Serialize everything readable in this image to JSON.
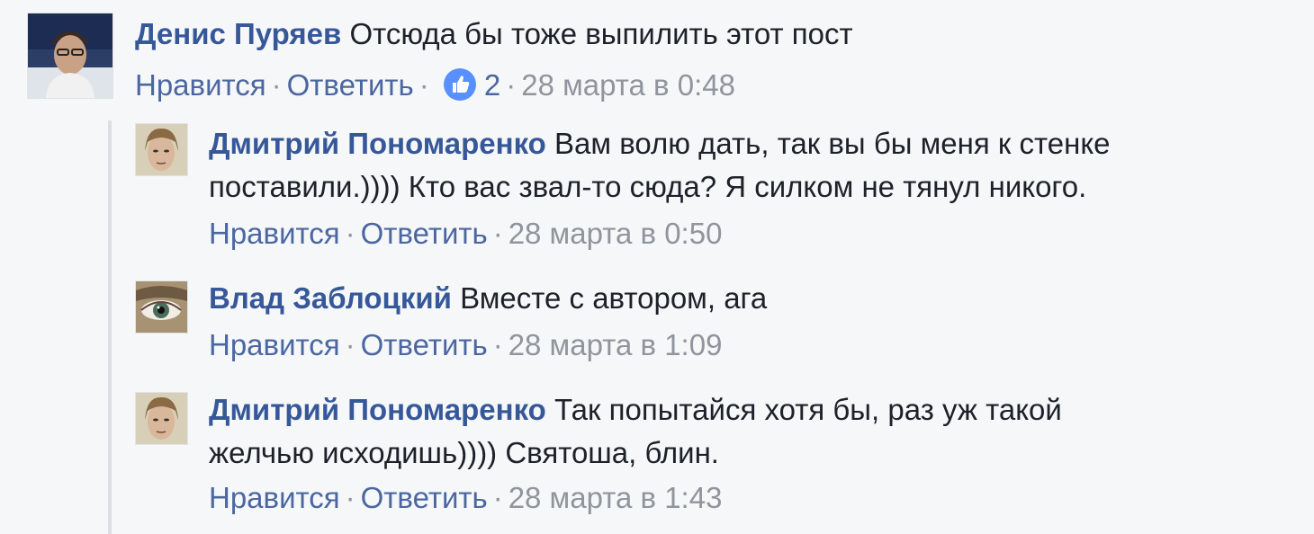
{
  "comments": [
    {
      "author": "Денис Пуряев",
      "body": "Отсюда бы тоже выпилить этот пост",
      "like_label": "Нравится",
      "reply_label": "Ответить",
      "likes": "2",
      "time": "28 марта в 0:48"
    }
  ],
  "replies": [
    {
      "author": "Дмитрий Пономаренко",
      "body_line1": "Вам волю дать, так вы бы меня к стенке",
      "body_line2": "поставили.)))) Кто вас звал-то сюда? Я силком не тянул никого.",
      "like_label": "Нравится",
      "reply_label": "Ответить",
      "time": "28 марта в 0:50"
    },
    {
      "author": "Влад Заблоцкий",
      "body_line1": "Вместе с автором, ага",
      "like_label": "Нравится",
      "reply_label": "Ответить",
      "time": "28 марта в 1:09"
    },
    {
      "author": "Дмитрий Пономаренко",
      "body_line1": "Так попытайся хотя бы, раз уж такой",
      "body_line2": "желчью исходишь)))) Святоша, блин.",
      "like_label": "Нравится",
      "reply_label": "Ответить",
      "time": "28 марта в 1:43"
    }
  ],
  "separator": "·",
  "colors": {
    "background": "#f6f7f9",
    "author": "#365899",
    "link": "#4b67a1",
    "meta": "#90949c",
    "like_badge": "#5890ff"
  }
}
